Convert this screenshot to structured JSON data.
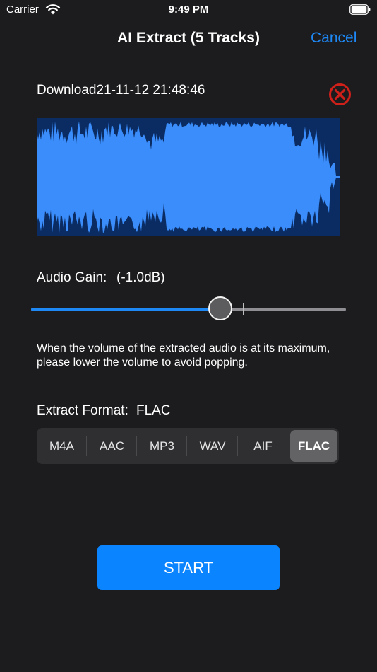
{
  "status": {
    "carrier": "Carrier",
    "time": "9:49 PM"
  },
  "nav": {
    "title": "AI Extract (5 Tracks)",
    "cancel": "Cancel"
  },
  "file": {
    "name": "Download21-11-12 21:48:46"
  },
  "gain": {
    "label": "Audio Gain:",
    "value": "(-1.0dB)",
    "level": 0.6
  },
  "hint": "When the volume of the extracted audio is at its maximum, please lower the volume to avoid popping.",
  "format": {
    "label": "Extract Format:",
    "value": "FLAC",
    "options": [
      "M4A",
      "AAC",
      "MP3",
      "WAV",
      "AIF",
      "FLAC"
    ],
    "selected_index": 5
  },
  "start": "START",
  "colors": {
    "accent": "#0a84ff",
    "waveform": "#3a8dfb",
    "waveform_bg": "#0b2c62",
    "remove": "#d0201a"
  }
}
